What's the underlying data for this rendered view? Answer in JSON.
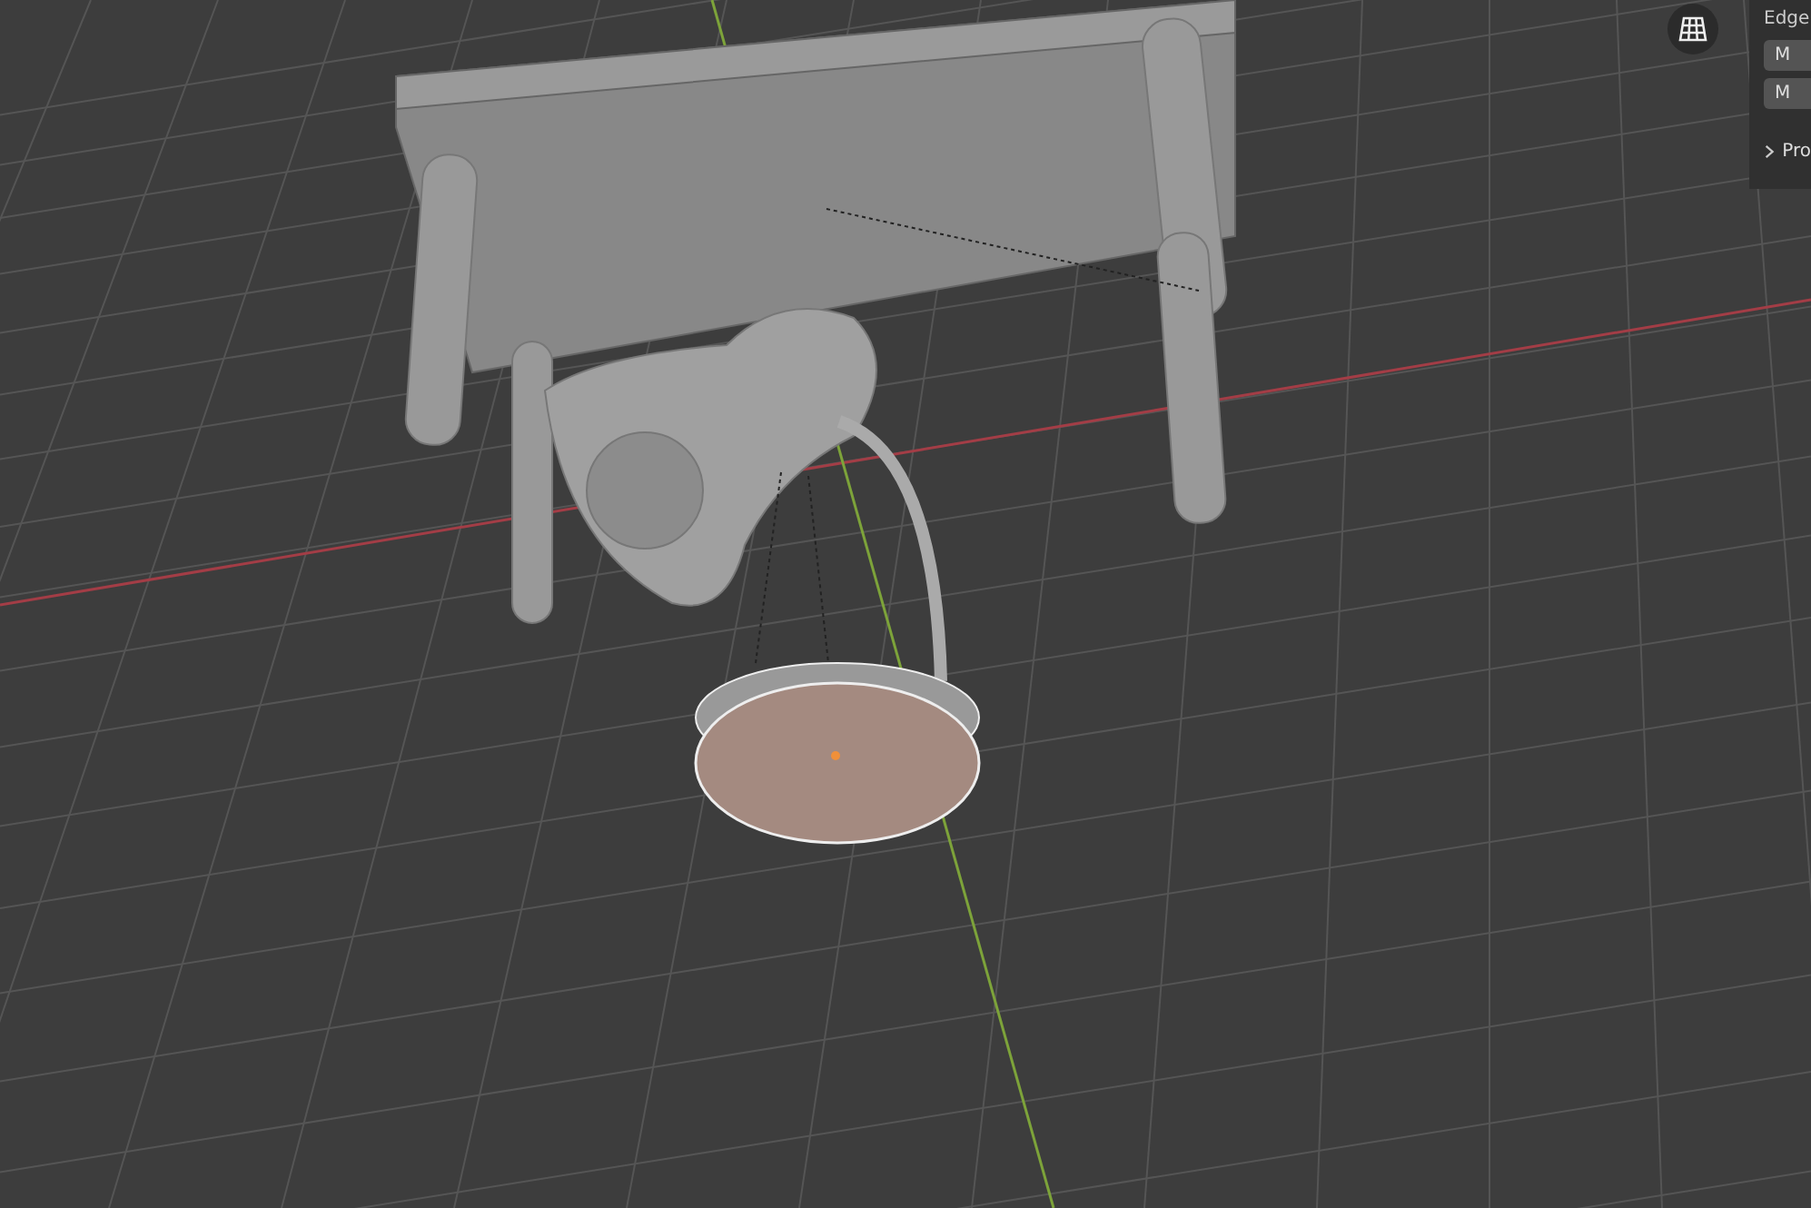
{
  "side_panel": {
    "title": "Edge",
    "buttons": [
      "M",
      "M"
    ],
    "section": {
      "label": "Pro",
      "expanded": false
    }
  }
}
